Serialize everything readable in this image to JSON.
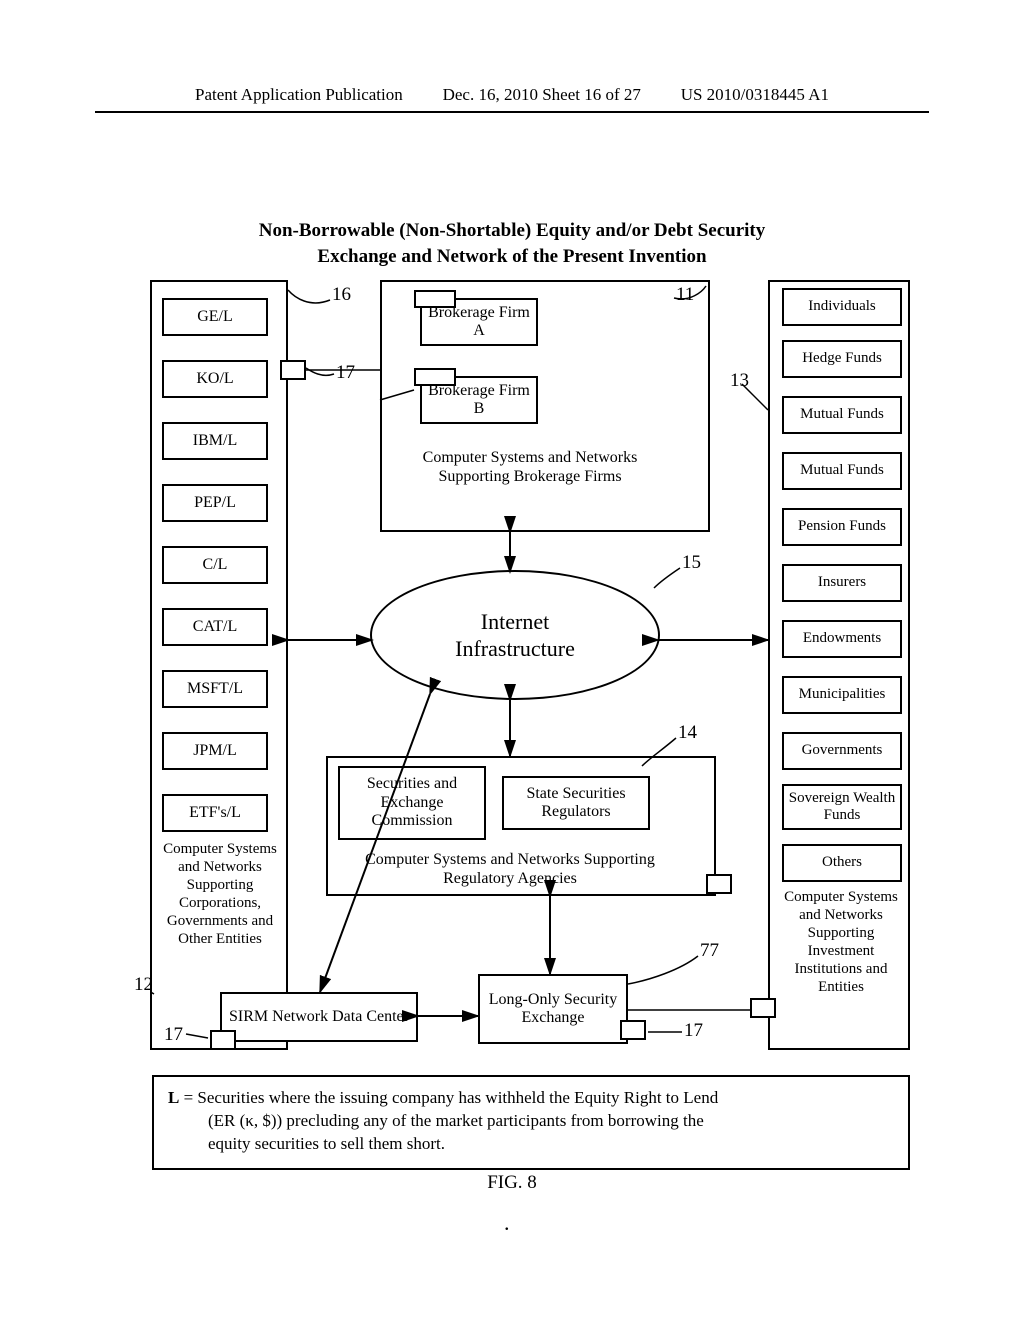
{
  "header": {
    "left": "Patent Application Publication",
    "center": "Dec. 16, 2010   Sheet 16 of 27",
    "right": "US 2010/0318445 A1"
  },
  "title_line1": "Non-Borrowable (Non-Shortable) Equity and/or Debt Security",
  "title_line2": "Exchange and Network of the Present Invention",
  "left_items": [
    "GE/L",
    "KO/L",
    "IBM/L",
    "PEP/L",
    "C/L",
    "CAT/L",
    "MSFT/L",
    "JPM/L",
    "ETF's/L"
  ],
  "left_caption": "Computer Systems and Networks Supporting Corporations, Governments and Other Entities",
  "right_items": [
    "Individuals",
    "Hedge Funds",
    "Mutual Funds",
    "Mutual Funds",
    "Pension Funds",
    "Insurers",
    "Endowments",
    "Municipalities",
    "Governments",
    "Sovereign Wealth Funds",
    "Others"
  ],
  "right_caption": "Computer Systems and Networks Supporting Investment Institutions and Entities",
  "brokerage_a": "Brokerage Firm A",
  "brokerage_b": "Brokerage Firm B",
  "brokerage_caption": "Computer Systems and Networks Supporting Brokerage Firms",
  "internet": "Internet\nInfrastructure",
  "sec": "Securities and Exchange Commission",
  "state_reg": "State Securities Regulators",
  "reg_caption": "Computer Systems and Networks Supporting Regulatory Agencies",
  "sirm": "SIRM Network Data Center",
  "long_only": "Long-Only Security Exchange",
  "refs": {
    "r11": "11",
    "r12": "12",
    "r13": "13",
    "r14": "14",
    "r15": "15",
    "r16": "16",
    "r17a": "17",
    "r17b": "17",
    "r17c": "17",
    "r77": "77"
  },
  "footnote_lead": "L",
  "footnote_text1": " = Securities where the issuing company has withheld the Equity Right to Lend",
  "footnote_text2": "(ER (κ, $)) precluding any of the market participants from borrowing the",
  "footnote_text3": "equity securities to sell them short.",
  "fig": "FIG. 8"
}
